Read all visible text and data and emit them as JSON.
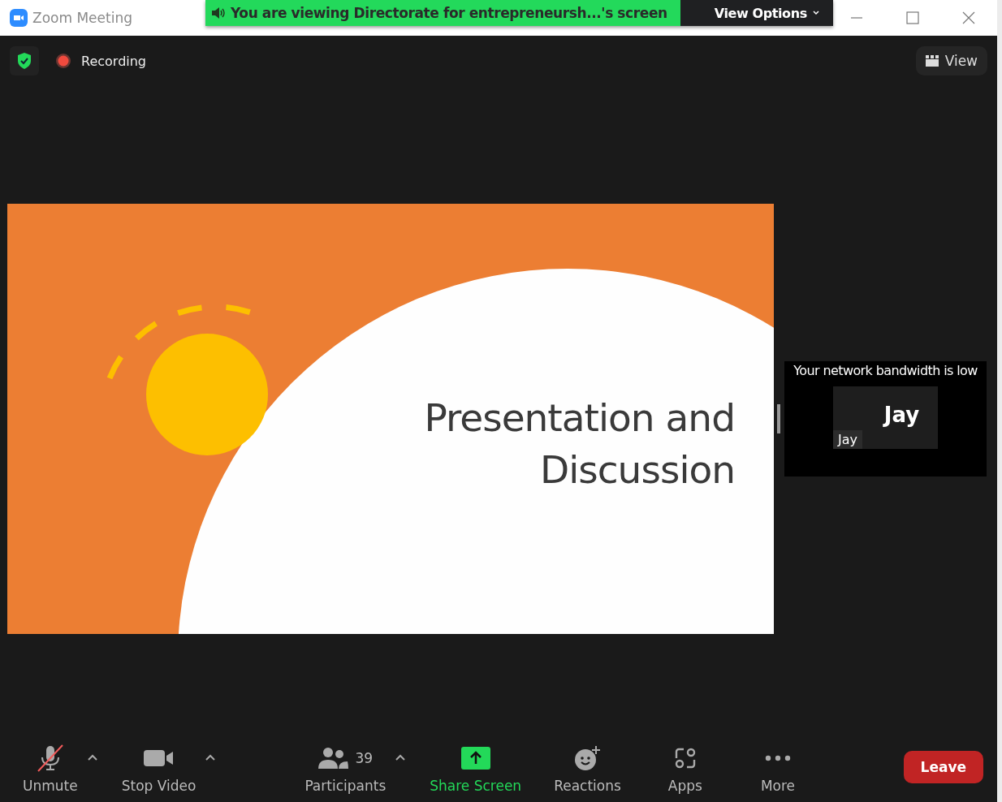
{
  "window": {
    "title": "Zoom Meeting"
  },
  "share_banner": {
    "message": "You are viewing Directorate for entrepreneursh...'s screen",
    "view_options": "View Options"
  },
  "top_bar": {
    "recording": "Recording",
    "view": "View"
  },
  "slide": {
    "title_lines": [
      "Presentation and",
      "Discussion"
    ]
  },
  "video_panel": {
    "notice": "Your network bandwidth is low",
    "participant_display": "Jay",
    "participant_label": "Jay"
  },
  "toolbar": [
    {
      "kind": "mic",
      "label": "Unmute",
      "muted": true,
      "caret": true
    },
    {
      "kind": "video",
      "label": "Stop Video",
      "caret": true
    },
    {
      "kind": "participants",
      "label": "Participants",
      "count": "39",
      "caret": true
    },
    {
      "kind": "share",
      "label": "Share Screen",
      "caret": false
    },
    {
      "kind": "reactions",
      "label": "Reactions",
      "caret": false
    },
    {
      "kind": "apps",
      "label": "Apps",
      "caret": false
    },
    {
      "kind": "more",
      "label": "More",
      "caret": false
    }
  ],
  "leave_button": "Leave"
}
